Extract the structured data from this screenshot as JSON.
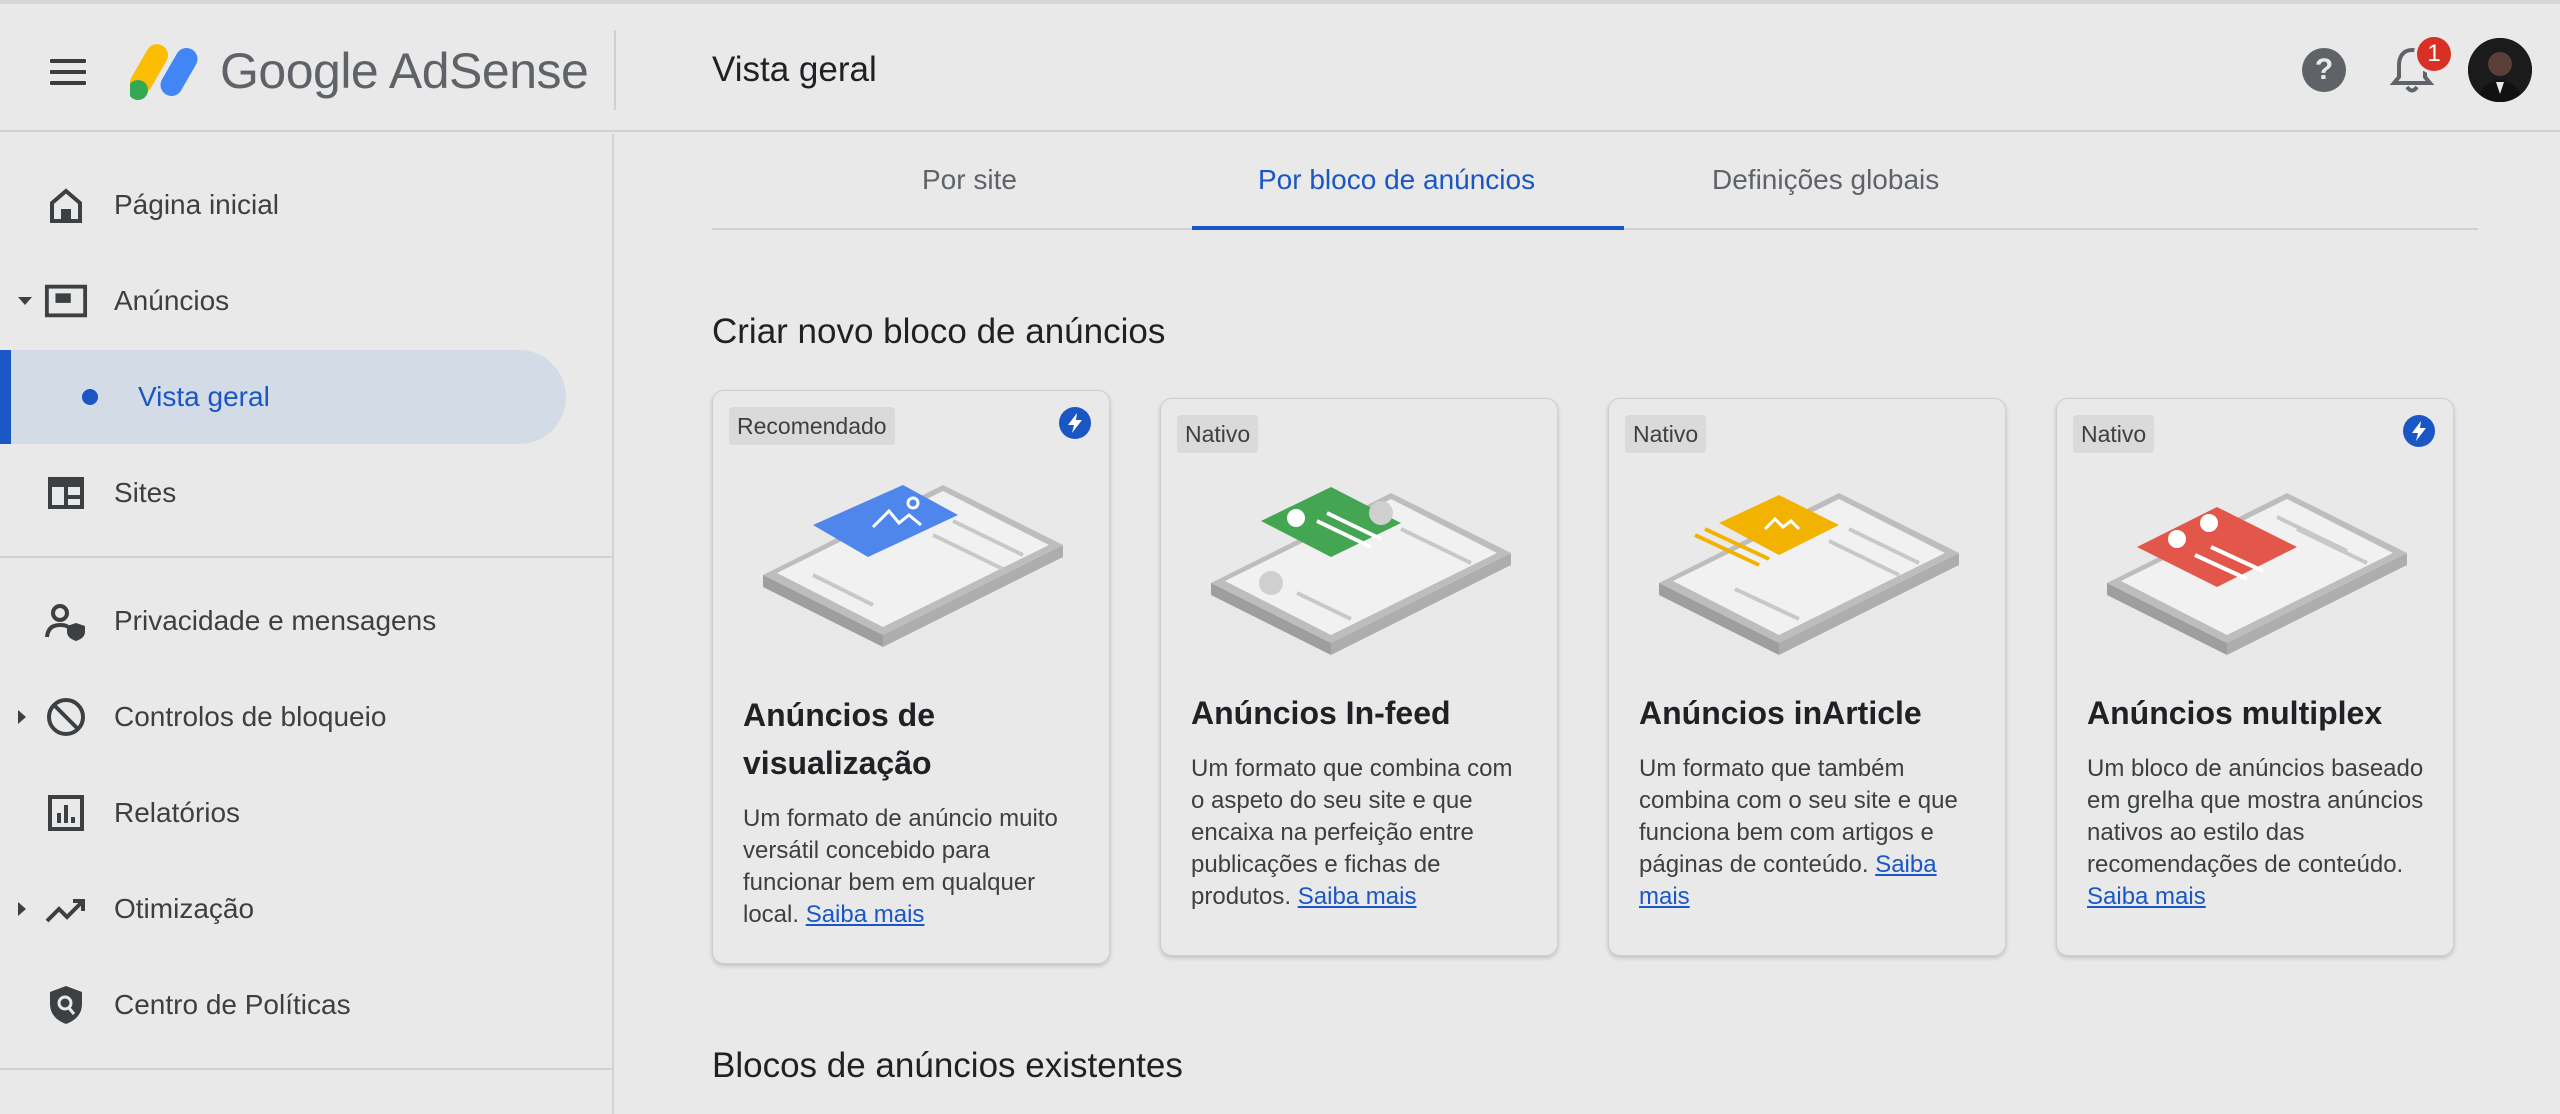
{
  "header": {
    "brand_google": "Google",
    "brand_product": "AdSense",
    "page_title": "Vista geral",
    "help_icon_glyph": "?",
    "notification_count": "1"
  },
  "sidebar": {
    "items": [
      {
        "label": "Página inicial",
        "icon": "home-icon"
      },
      {
        "label": "Anúncios",
        "icon": "ads-icon"
      },
      {
        "label": "Vista geral",
        "icon": "dot"
      },
      {
        "label": "Sites",
        "icon": "sites-icon"
      },
      {
        "label": "Privacidade e mensagens",
        "icon": "privacy-icon"
      },
      {
        "label": "Controlos de bloqueio",
        "icon": "block-icon"
      },
      {
        "label": "Relatórios",
        "icon": "reports-icon"
      },
      {
        "label": "Otimização",
        "icon": "trending-icon"
      },
      {
        "label": "Centro de Políticas",
        "icon": "policy-shield-icon"
      }
    ]
  },
  "tabs": [
    {
      "label": "Por site"
    },
    {
      "label": "Por bloco de anúncios"
    },
    {
      "label": "Definições globais"
    }
  ],
  "section_new": "Criar novo bloco de anúncios",
  "section_existing": "Blocos de anúncios existentes",
  "cards": [
    {
      "chip": "Recomendado",
      "title_line1": "Anúncios de",
      "title_line2": "visualização",
      "desc": "Um formato de anúncio muito versátil concebido para funcionar bem em qualquer local.",
      "link": "Saiba mais",
      "accent": "#4f86ec"
    },
    {
      "chip": "Nativo",
      "title_line1": "Anúncios In-feed",
      "desc": "Um formato que combina com o aspeto do seu site e que encaixa na perfeição entre publicações e fichas de produtos.",
      "link": "Saiba mais",
      "accent": "#44a552"
    },
    {
      "chip": "Nativo",
      "title_line1": "Anúncios inArticle",
      "desc": "Um formato que também combina com o seu site e que funciona bem com artigos e páginas de conteúdo.",
      "link": "Saiba mais",
      "accent": "#f2b300"
    },
    {
      "chip": "Nativo",
      "title_line1": "Anúncios multiplex",
      "desc": "Um bloco de anúncios baseado em grelha que mostra anúncios nativos ao estilo das recomendações de conteúdo.",
      "link": "Saiba mais",
      "accent": "#e3564a"
    }
  ],
  "colors": {
    "primary": "#1a56c4",
    "badge": "#d93025",
    "background": "#e9e9e9"
  }
}
